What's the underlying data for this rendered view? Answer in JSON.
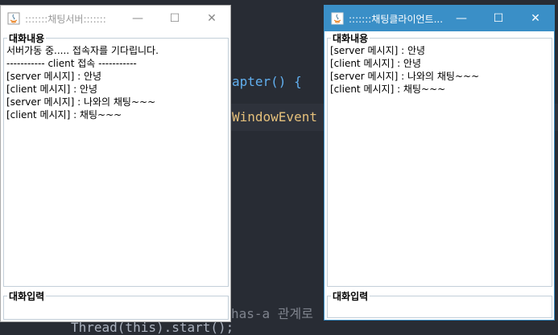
{
  "background_code": {
    "line1": "apter() {",
    "line2": "WindowEvent e",
    "line3": "has-a 관계로 ",
    "line4": "Thread(this).start();"
  },
  "server": {
    "title": ":::::::채팅서버:::::::",
    "chat_legend": "대화내용",
    "input_legend": "대화입력",
    "lines": [
      "서버가동 중..... 접속자를 기다립니다.",
      "----------- client 접속 -----------",
      "[server 메시지] : 안녕",
      "[client 메시지] : 안녕",
      "[server 메시지] : 나와의 채팅~~~",
      "[client 메시지] : 채팅~~~"
    ],
    "controls": {
      "minimize": "—",
      "maximize": "☐",
      "close": "✕"
    }
  },
  "client": {
    "title": ":::::::채팅클라이언트...",
    "chat_legend": "대화내용",
    "input_legend": "대화입력",
    "lines": [
      "[server 메시지] : 안녕",
      "[client 메시지] : 안녕",
      "[server 메시지] : 나와의 채팅~~~",
      "[client 메시지] : 채팅~~~"
    ],
    "controls": {
      "minimize": "—",
      "maximize": "☐",
      "close": "✕"
    }
  },
  "colors": {
    "active_titlebar": "#3a8fc7",
    "inactive_titlebar": "#ffffff",
    "editor_bg": "#282c34"
  }
}
